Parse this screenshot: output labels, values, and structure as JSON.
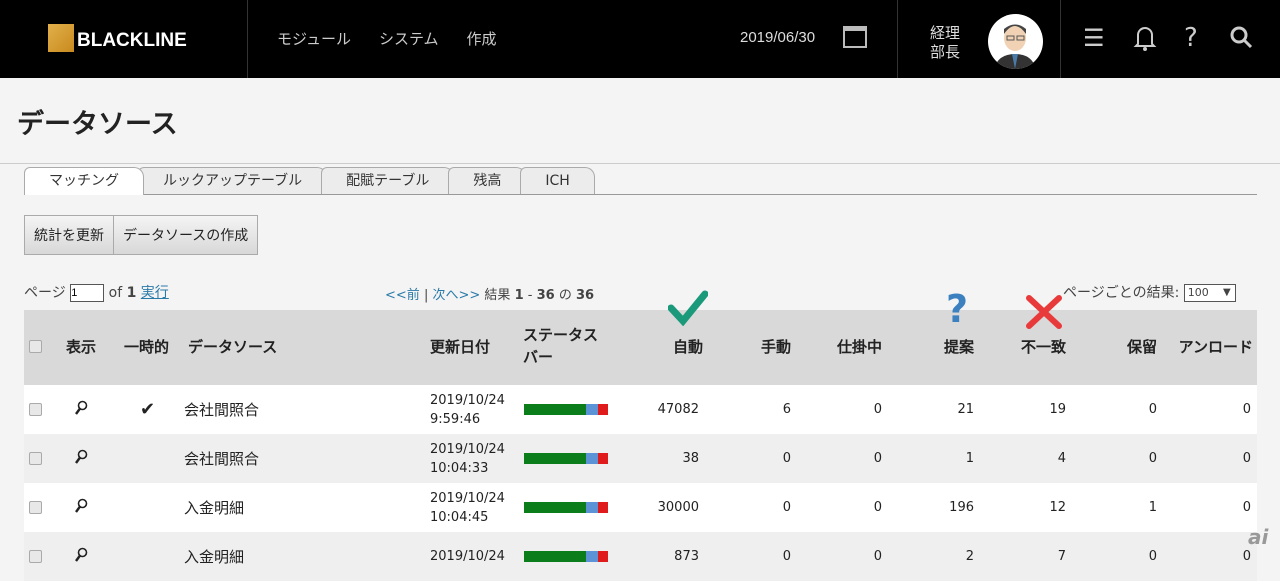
{
  "header": {
    "logo": "BLACKLINE",
    "nav": [
      "モジュール",
      "システム",
      "作成"
    ],
    "date": "2019/06/30",
    "role_line1": "経理",
    "role_line2": "部長"
  },
  "page": {
    "title": "データソース"
  },
  "tabs": [
    "マッチング",
    "ルックアップテーブル",
    "配賦テーブル",
    "残高",
    "ICH"
  ],
  "buttons": {
    "refresh": "統計を更新",
    "create": "データソースの作成"
  },
  "pagination": {
    "page_label": "ページ",
    "page_value": "1",
    "of": "of",
    "total_pages": "1",
    "go": "実行",
    "prev": "<<前",
    "sep": "|",
    "next": "次へ>>",
    "results_label": "結果",
    "range_start": "1",
    "dash": "-",
    "range_end": "36",
    "of_jp": "の",
    "total": "36",
    "per_page_label": "ページごとの結果:",
    "per_page": "100"
  },
  "colors": {
    "green": "#0b7d1a",
    "blue": "#5b93d6",
    "red": "#e01b1b",
    "check": "#1a9a7a",
    "question": "#3c80c0",
    "cross": "#e83a3a"
  },
  "table": {
    "headers": [
      "表示",
      "一時的",
      "データソース",
      "更新日付",
      "ステータスバー",
      "自動",
      "手動",
      "仕掛中",
      "提案",
      "不一致",
      "保留",
      "アンロード"
    ],
    "status_header_l1": "ステータス",
    "status_header_l2": "バー",
    "rows": [
      {
        "temp": "✔",
        "name": "会社間照合",
        "date": "2019/10/24",
        "time": "9:59:46",
        "auto": "47082",
        "manual": "6",
        "wip": "0",
        "proposed": "21",
        "mismatch": "19",
        "hold": "0",
        "unload": "0"
      },
      {
        "temp": "",
        "name": "会社間照合",
        "date": "2019/10/24",
        "time": "10:04:33",
        "auto": "38",
        "manual": "0",
        "wip": "0",
        "proposed": "1",
        "mismatch": "4",
        "hold": "0",
        "unload": "0"
      },
      {
        "temp": "",
        "name": "入金明細",
        "date": "2019/10/24",
        "time": "10:04:45",
        "auto": "30000",
        "manual": "0",
        "wip": "0",
        "proposed": "196",
        "mismatch": "12",
        "hold": "1",
        "unload": "0"
      },
      {
        "temp": "",
        "name": "入金明細",
        "date": "2019/10/24",
        "time": "",
        "auto": "873",
        "manual": "0",
        "wip": "0",
        "proposed": "2",
        "mismatch": "7",
        "hold": "0",
        "unload": "0"
      }
    ]
  }
}
